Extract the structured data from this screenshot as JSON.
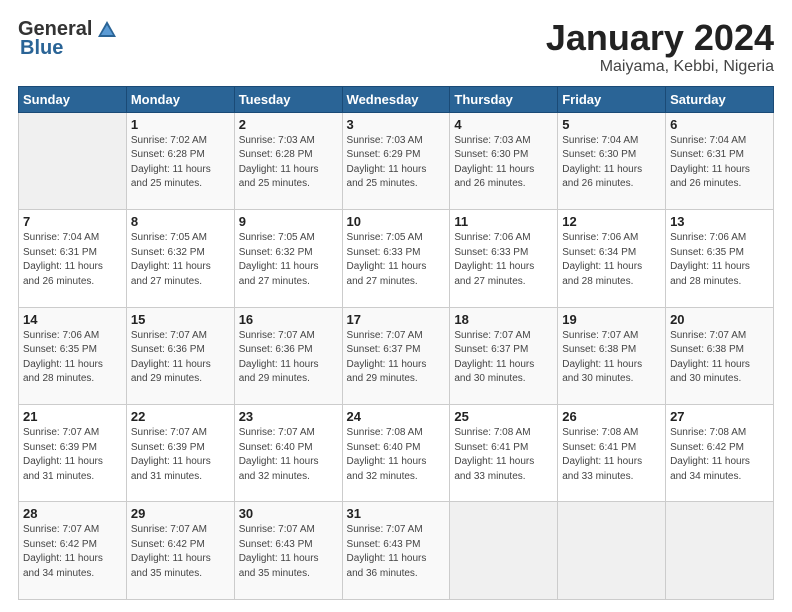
{
  "logo": {
    "general": "General",
    "blue": "Blue"
  },
  "calendar": {
    "title": "January 2024",
    "subtitle": "Maiyama, Kebbi, Nigeria",
    "days_of_week": [
      "Sunday",
      "Monday",
      "Tuesday",
      "Wednesday",
      "Thursday",
      "Friday",
      "Saturday"
    ],
    "weeks": [
      [
        {
          "day": "",
          "info": ""
        },
        {
          "day": "1",
          "info": "Sunrise: 7:02 AM\nSunset: 6:28 PM\nDaylight: 11 hours and 25 minutes."
        },
        {
          "day": "2",
          "info": "Sunrise: 7:03 AM\nSunset: 6:28 PM\nDaylight: 11 hours and 25 minutes."
        },
        {
          "day": "3",
          "info": "Sunrise: 7:03 AM\nSunset: 6:29 PM\nDaylight: 11 hours and 25 minutes."
        },
        {
          "day": "4",
          "info": "Sunrise: 7:03 AM\nSunset: 6:30 PM\nDaylight: 11 hours and 26 minutes."
        },
        {
          "day": "5",
          "info": "Sunrise: 7:04 AM\nSunset: 6:30 PM\nDaylight: 11 hours and 26 minutes."
        },
        {
          "day": "6",
          "info": "Sunrise: 7:04 AM\nSunset: 6:31 PM\nDaylight: 11 hours and 26 minutes."
        }
      ],
      [
        {
          "day": "7",
          "info": "Sunrise: 7:04 AM\nSunset: 6:31 PM\nDaylight: 11 hours and 26 minutes."
        },
        {
          "day": "8",
          "info": "Sunrise: 7:05 AM\nSunset: 6:32 PM\nDaylight: 11 hours and 27 minutes."
        },
        {
          "day": "9",
          "info": "Sunrise: 7:05 AM\nSunset: 6:32 PM\nDaylight: 11 hours and 27 minutes."
        },
        {
          "day": "10",
          "info": "Sunrise: 7:05 AM\nSunset: 6:33 PM\nDaylight: 11 hours and 27 minutes."
        },
        {
          "day": "11",
          "info": "Sunrise: 7:06 AM\nSunset: 6:33 PM\nDaylight: 11 hours and 27 minutes."
        },
        {
          "day": "12",
          "info": "Sunrise: 7:06 AM\nSunset: 6:34 PM\nDaylight: 11 hours and 28 minutes."
        },
        {
          "day": "13",
          "info": "Sunrise: 7:06 AM\nSunset: 6:35 PM\nDaylight: 11 hours and 28 minutes."
        }
      ],
      [
        {
          "day": "14",
          "info": "Sunrise: 7:06 AM\nSunset: 6:35 PM\nDaylight: 11 hours and 28 minutes."
        },
        {
          "day": "15",
          "info": "Sunrise: 7:07 AM\nSunset: 6:36 PM\nDaylight: 11 hours and 29 minutes."
        },
        {
          "day": "16",
          "info": "Sunrise: 7:07 AM\nSunset: 6:36 PM\nDaylight: 11 hours and 29 minutes."
        },
        {
          "day": "17",
          "info": "Sunrise: 7:07 AM\nSunset: 6:37 PM\nDaylight: 11 hours and 29 minutes."
        },
        {
          "day": "18",
          "info": "Sunrise: 7:07 AM\nSunset: 6:37 PM\nDaylight: 11 hours and 30 minutes."
        },
        {
          "day": "19",
          "info": "Sunrise: 7:07 AM\nSunset: 6:38 PM\nDaylight: 11 hours and 30 minutes."
        },
        {
          "day": "20",
          "info": "Sunrise: 7:07 AM\nSunset: 6:38 PM\nDaylight: 11 hours and 30 minutes."
        }
      ],
      [
        {
          "day": "21",
          "info": "Sunrise: 7:07 AM\nSunset: 6:39 PM\nDaylight: 11 hours and 31 minutes."
        },
        {
          "day": "22",
          "info": "Sunrise: 7:07 AM\nSunset: 6:39 PM\nDaylight: 11 hours and 31 minutes."
        },
        {
          "day": "23",
          "info": "Sunrise: 7:07 AM\nSunset: 6:40 PM\nDaylight: 11 hours and 32 minutes."
        },
        {
          "day": "24",
          "info": "Sunrise: 7:08 AM\nSunset: 6:40 PM\nDaylight: 11 hours and 32 minutes."
        },
        {
          "day": "25",
          "info": "Sunrise: 7:08 AM\nSunset: 6:41 PM\nDaylight: 11 hours and 33 minutes."
        },
        {
          "day": "26",
          "info": "Sunrise: 7:08 AM\nSunset: 6:41 PM\nDaylight: 11 hours and 33 minutes."
        },
        {
          "day": "27",
          "info": "Sunrise: 7:08 AM\nSunset: 6:42 PM\nDaylight: 11 hours and 34 minutes."
        }
      ],
      [
        {
          "day": "28",
          "info": "Sunrise: 7:07 AM\nSunset: 6:42 PM\nDaylight: 11 hours and 34 minutes."
        },
        {
          "day": "29",
          "info": "Sunrise: 7:07 AM\nSunset: 6:42 PM\nDaylight: 11 hours and 35 minutes."
        },
        {
          "day": "30",
          "info": "Sunrise: 7:07 AM\nSunset: 6:43 PM\nDaylight: 11 hours and 35 minutes."
        },
        {
          "day": "31",
          "info": "Sunrise: 7:07 AM\nSunset: 6:43 PM\nDaylight: 11 hours and 36 minutes."
        },
        {
          "day": "",
          "info": ""
        },
        {
          "day": "",
          "info": ""
        },
        {
          "day": "",
          "info": ""
        }
      ]
    ]
  }
}
